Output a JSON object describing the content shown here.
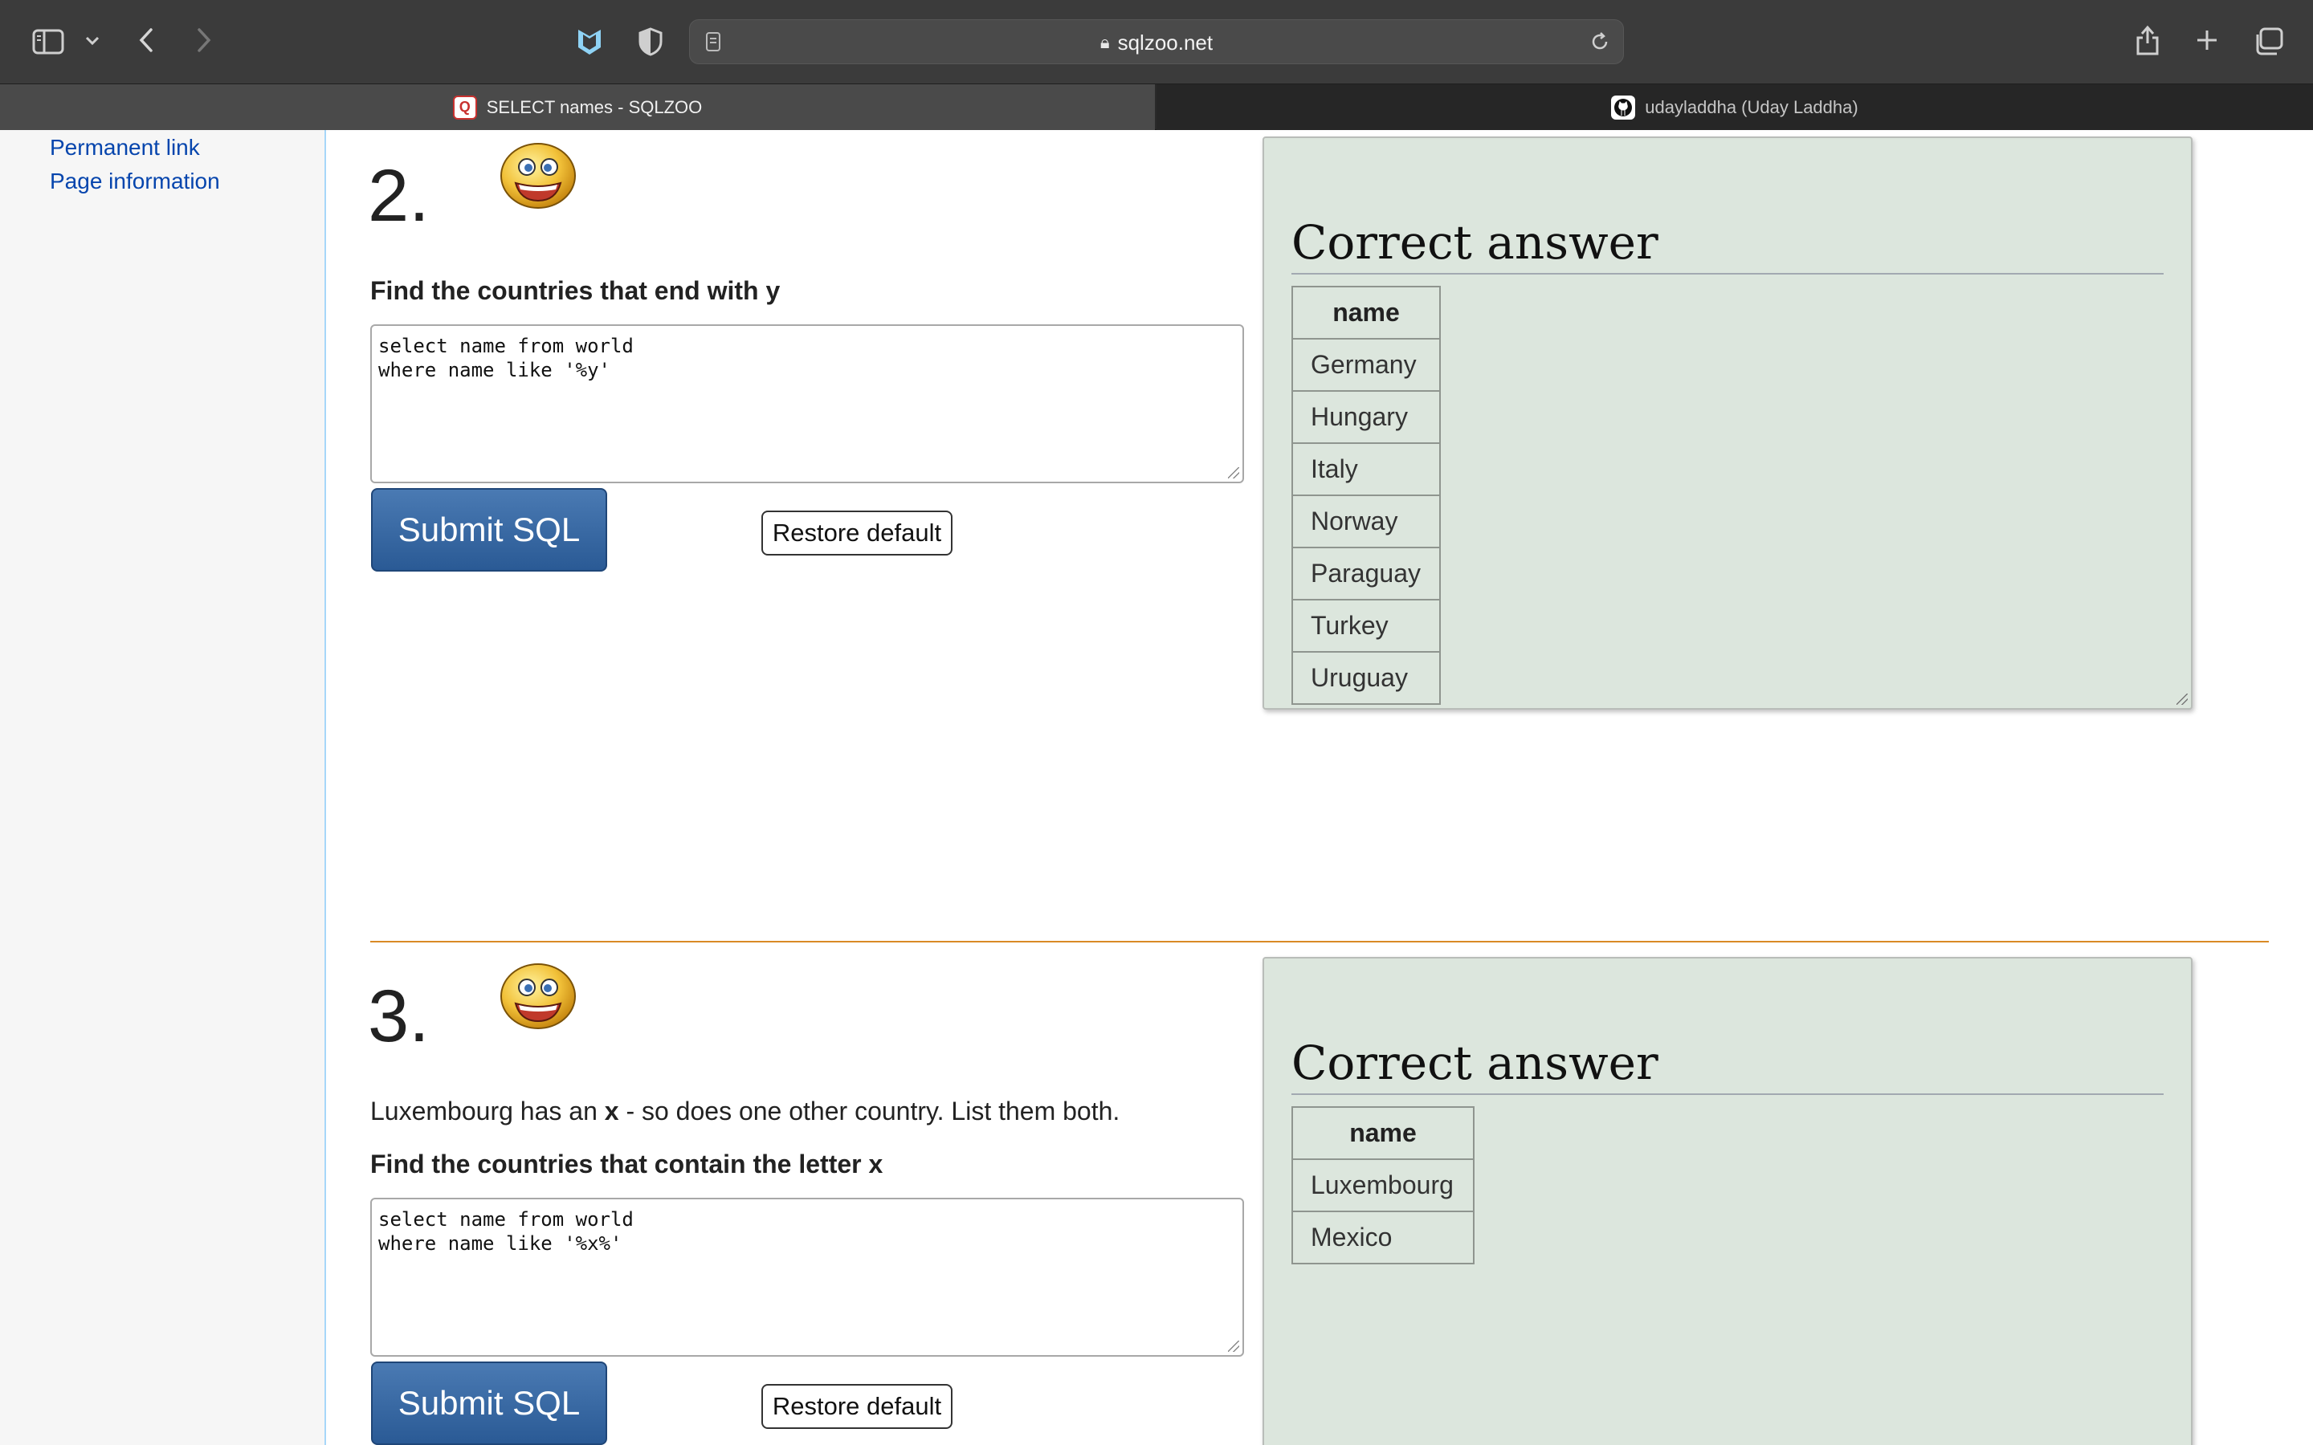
{
  "browser": {
    "url": "sqlzoo.net",
    "tabs": [
      {
        "label": "SELECT names - SQLZOO",
        "favicon": "sqlzoo-icon",
        "active": true
      },
      {
        "label": "udayladdha (Uday Laddha)",
        "favicon": "github-icon",
        "active": false
      }
    ]
  },
  "sidebar": {
    "links": [
      "Permanent link",
      "Page information"
    ]
  },
  "questions": [
    {
      "number": "2.",
      "intro": "",
      "task": "Find the countries that end with y",
      "sql": "select name from world\nwhere name like '%y'",
      "submit_label": "Submit SQL",
      "restore_label": "Restore default",
      "answer": {
        "title": "Correct answer",
        "header": "name",
        "rows": [
          "Germany",
          "Hungary",
          "Italy",
          "Norway",
          "Paraguay",
          "Turkey",
          "Uruguay"
        ]
      }
    },
    {
      "number": "3.",
      "intro_pre": "Luxembourg has an ",
      "intro_bold": "x",
      "intro_post": " - so does one other country. List them both.",
      "task": "Find the countries that contain the letter x",
      "sql": "select name from world\nwhere name like '%x%'",
      "submit_label": "Submit SQL",
      "restore_label": "Restore default",
      "answer": {
        "title": "Correct answer",
        "header": "name",
        "rows": [
          "Luxembourg",
          "Mexico"
        ]
      }
    }
  ],
  "colors": {
    "submit": "#2f5f9b",
    "answer_panel": "#dce6dd",
    "divider": "#d98a25",
    "link": "#0645ad"
  }
}
